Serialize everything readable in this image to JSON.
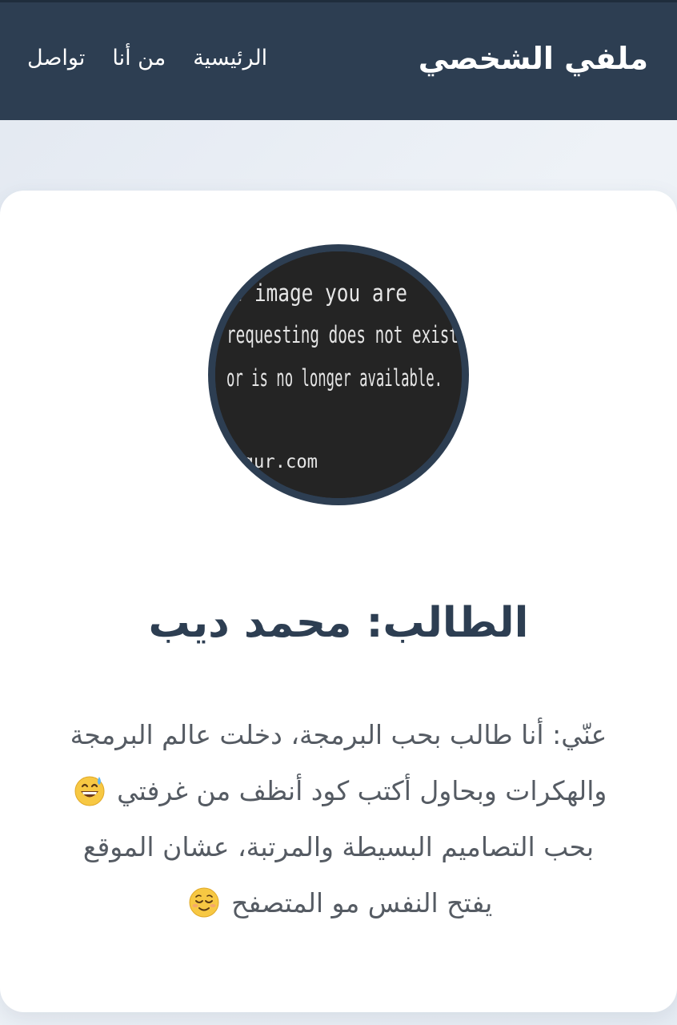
{
  "header": {
    "brand": "ملفي الشخصي",
    "nav": [
      {
        "label": "الرئيسية"
      },
      {
        "label": "من أنا"
      },
      {
        "label": "تواصل"
      }
    ]
  },
  "profile": {
    "avatar_placeholder_lines": [
      "The image you are",
      "requesting does not exist",
      "or is no longer available.",
      "imgur.com"
    ],
    "name": "الطالب: محمد ديب",
    "bio_lines": [
      "عنّي: أنا طالب بحب البرمجة، دخلت عالم البرمجة",
      "والهكرات وبحاول أكتب كود أنظف من غرفتي",
      "بحب التصاميم البسيطة والمرتبة، عشان الموقع",
      "يفتح النفس مو المتصفح"
    ],
    "emojis": {
      "line2": "grinning-sweat-emoji",
      "line4": "relieved-face-emoji"
    }
  },
  "colors": {
    "header_bg": "#2d3e52",
    "title_text": "#2d3e52",
    "body_text": "#555b63",
    "card_bg": "#ffffff"
  }
}
